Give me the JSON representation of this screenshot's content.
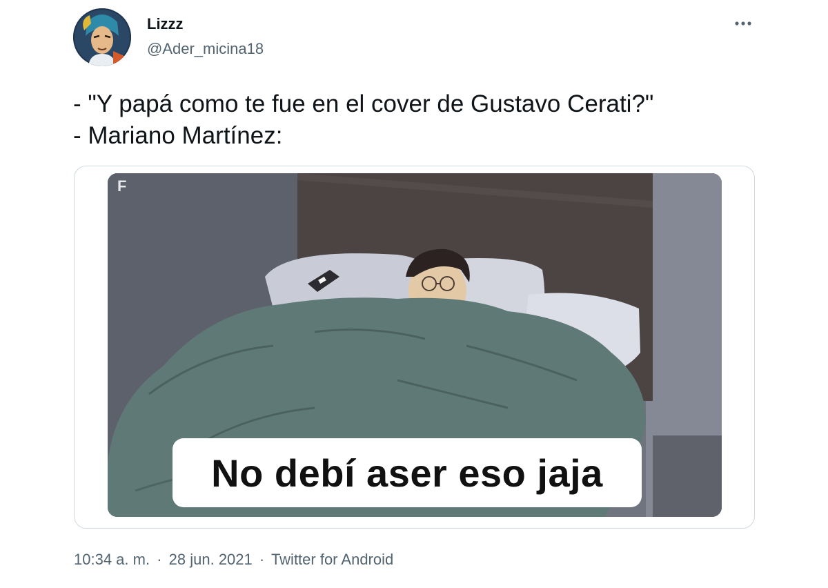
{
  "user": {
    "display_name": "Lizzz",
    "handle": "@Ader_micina18"
  },
  "menu": {
    "icon": "more-horizontal-icon"
  },
  "tweet": {
    "text": "- \"Y papá como te fue en el cover de Gustavo Cerati?\"\n- Mariano Martínez:"
  },
  "media": {
    "caption": "No debí aser eso jaja",
    "watermark": "F"
  },
  "meta": {
    "time": "10:34 a. m.",
    "date": "28 jun. 2021",
    "separator": "·",
    "source": "Twitter for Android"
  },
  "colors": {
    "text_primary": "#0f1419",
    "text_secondary": "#536471",
    "border": "#cfd9de",
    "blanket": "#5f7874",
    "wall": "#7c8091"
  }
}
